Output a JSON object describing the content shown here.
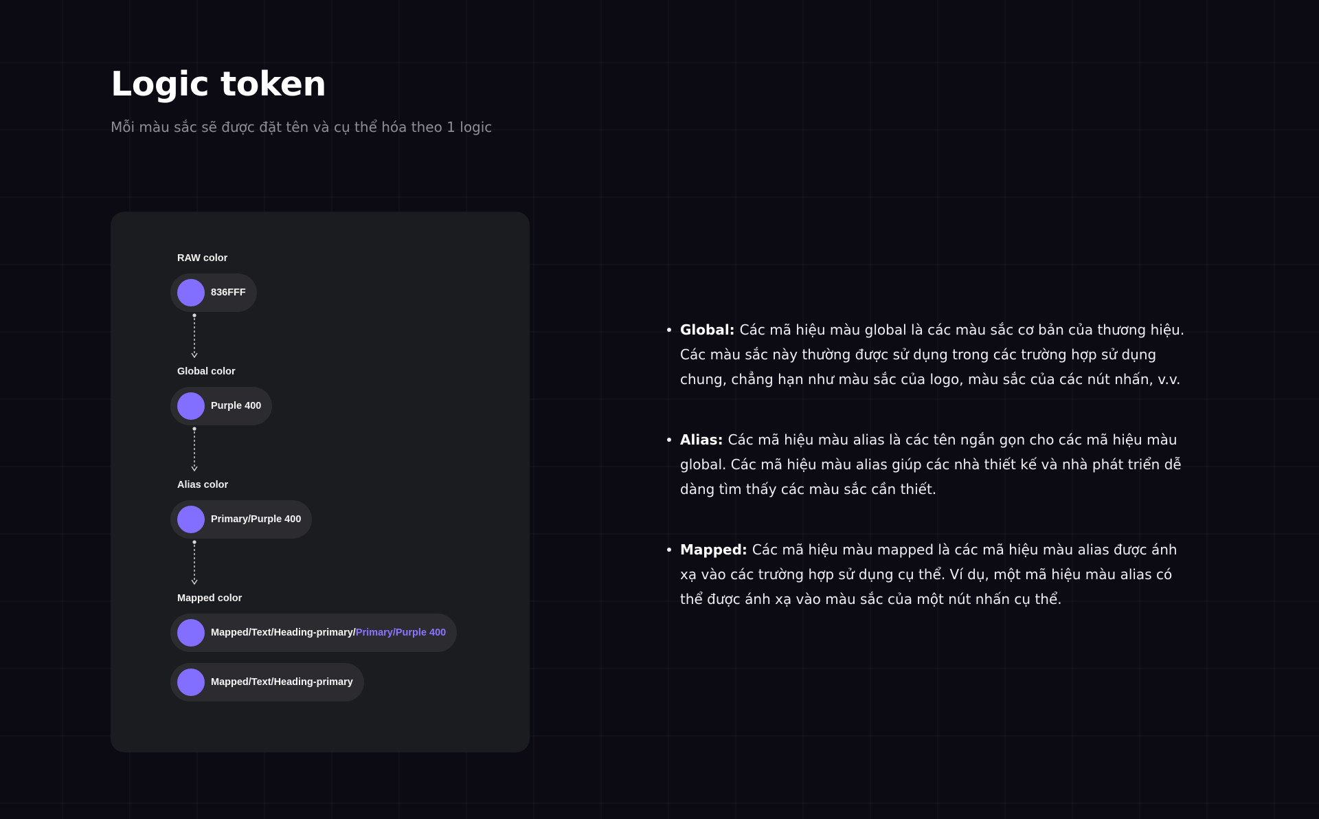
{
  "header": {
    "title": "Logic token",
    "subtitle": "Mỗi màu sắc sẽ được đặt tên và cụ thể hóa theo 1 logic"
  },
  "token_chain": {
    "swatch_color": "#836FFF",
    "accent_color": "#8B74FF",
    "raw": {
      "label": "RAW color",
      "value": "836FFF"
    },
    "global": {
      "label": "Global color",
      "value": "Purple 400"
    },
    "alias": {
      "label": "Alias color",
      "value": "Primary/Purple 400"
    },
    "mapped": {
      "label": "Mapped color",
      "value_full_prefix": "Mapped/Text/Heading-primary/",
      "value_full_suffix": "Primary/Purple 400",
      "value_short": "Mapped/Text/Heading-primary"
    }
  },
  "descriptions": [
    {
      "term": "Global:",
      "text": "Các mã hiệu màu global là các màu sắc cơ bản của thương hiệu. Các màu sắc này thường được sử dụng trong các trường hợp sử dụng chung, chẳng hạn như màu sắc của logo, màu sắc của các nút nhấn, v.v."
    },
    {
      "term": "Alias:",
      "text": "Các mã hiệu màu alias là các tên ngắn gọn cho các mã hiệu màu global. Các mã hiệu màu alias giúp các nhà thiết kế và nhà phát triển dễ dàng tìm thấy các màu sắc cần thiết."
    },
    {
      "term": "Mapped:",
      "text": "Các mã hiệu màu mapped là các mã hiệu màu alias được ánh xạ vào các trường hợp sử dụng cụ thể. Ví dụ, một mã hiệu màu alias có thể được ánh xạ vào màu sắc của một nút nhấn cụ thể."
    }
  ]
}
